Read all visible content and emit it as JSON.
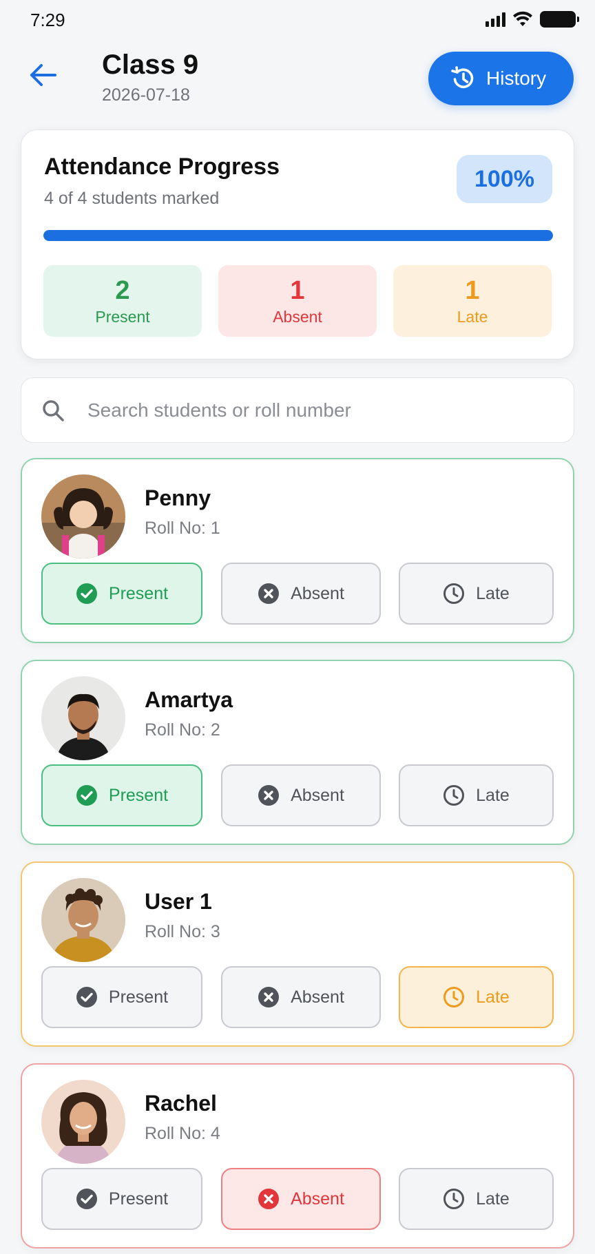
{
  "status_bar": {
    "time": "7:29"
  },
  "header": {
    "title": "Class 9",
    "date": "2026-07-18",
    "history_label": "History"
  },
  "progress": {
    "title": "Attendance Progress",
    "subtitle": "4 of 4 students marked",
    "percent_label": "100%",
    "percent_value": 1.0,
    "stats": {
      "present": {
        "count": "2",
        "label": "Present"
      },
      "absent": {
        "count": "1",
        "label": "Absent"
      },
      "late": {
        "count": "1",
        "label": "Late"
      }
    }
  },
  "search": {
    "placeholder": "Search students or roll number",
    "value": ""
  },
  "option_labels": {
    "present": "Present",
    "absent": "Absent",
    "late": "Late"
  },
  "students": [
    {
      "name": "Penny",
      "roll": "Roll No: 1",
      "status": "present"
    },
    {
      "name": "Amartya",
      "roll": "Roll No: 2",
      "status": "present"
    },
    {
      "name": "User 1",
      "roll": "Roll No: 3",
      "status": "late"
    },
    {
      "name": "Rachel",
      "roll": "Roll No: 4",
      "status": "absent"
    }
  ],
  "colors": {
    "accent": "#1b6fe0",
    "present": "#1f9d55",
    "absent": "#e2363a",
    "late": "#ee9a1c"
  }
}
